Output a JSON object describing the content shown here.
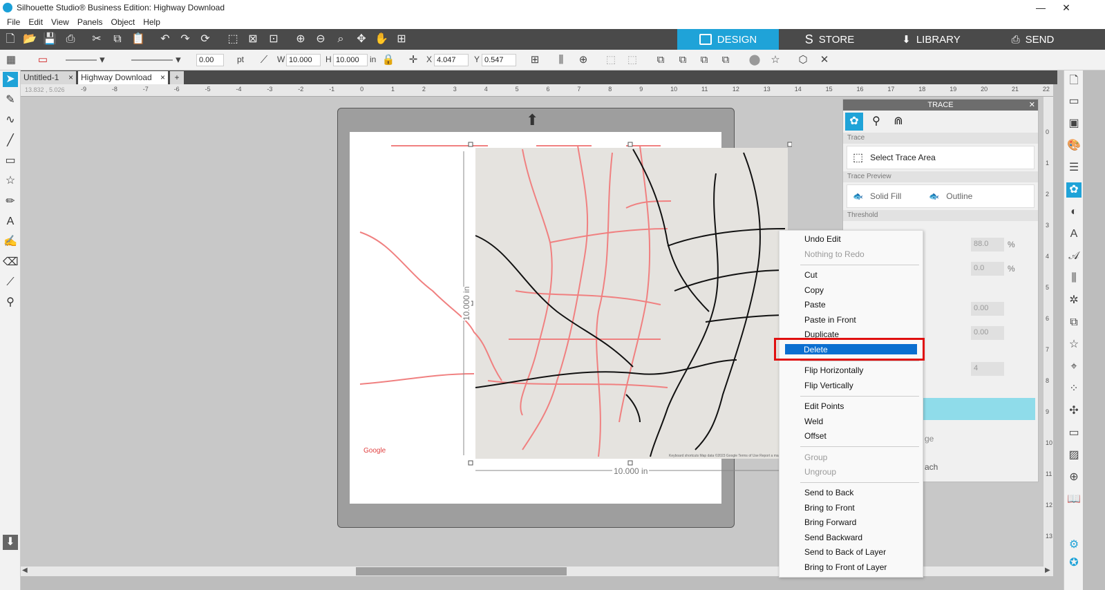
{
  "window": {
    "title": "Silhouette Studio® Business Edition: Highway Download",
    "minimize": "—",
    "maximize": "❐",
    "close": "✕"
  },
  "menu": [
    "File",
    "Edit",
    "View",
    "Panels",
    "Object",
    "Help"
  ],
  "nav_tabs": [
    {
      "label": "DESIGN",
      "active": true
    },
    {
      "label": "STORE"
    },
    {
      "label": "LIBRARY"
    },
    {
      "label": "SEND"
    }
  ],
  "properties": {
    "line_width": "0.00",
    "line_unit": "pt",
    "w_label": "W",
    "w_value": "10.000",
    "h_label": "H",
    "h_value": "10.000",
    "size_unit": "in",
    "x_label": "X",
    "x_value": "4.047",
    "y_label": "Y",
    "y_value": "0.547"
  },
  "doc_tabs": [
    {
      "label": "Untitled-1"
    },
    {
      "label": "Highway Download",
      "active": true
    }
  ],
  "add_tab": "+",
  "ruler": {
    "coords": "13.832 , 5.026",
    "h_ticks": [
      "-9",
      "-8",
      "-7",
      "-6",
      "-5",
      "-4",
      "-3",
      "-2",
      "-1",
      "0",
      "1",
      "2",
      "3",
      "4",
      "5",
      "6",
      "7",
      "8",
      "9",
      "10",
      "11",
      "12",
      "13",
      "14",
      "15",
      "16",
      "17",
      "18",
      "19",
      "20",
      "21",
      "22"
    ],
    "v_ticks": [
      "0",
      "1",
      "2",
      "3",
      "4",
      "5",
      "6",
      "7",
      "8",
      "9",
      "10",
      "11",
      "12",
      "13"
    ]
  },
  "canvas": {
    "height_dim": "10.000 in",
    "width_dim": "10.000 in",
    "google_logo": "Google",
    "map_footer": "Keyboard shortcuts   Map data ©2023 Google   Terms of Use   Report a map error"
  },
  "trace_panel": {
    "title": "TRACE",
    "section_trace": "Trace",
    "select_trace_area": "Select Trace Area",
    "section_preview": "Trace Preview",
    "solid_fill": "Solid Fill",
    "outline": "Outline",
    "section_threshold": "Threshold",
    "threshold_value": "88.0",
    "threshold_unit": "%",
    "field2_value": "0.0",
    "field2_unit": "%",
    "field3_value": "0.00",
    "field4_value": "0.00",
    "field5_value": "4",
    "partial1": "ge",
    "partial2": "ach"
  },
  "context_menu": [
    {
      "label": "Undo Edit",
      "enabled": true
    },
    {
      "label": "Nothing to Redo",
      "enabled": false
    },
    {
      "label": "Cut",
      "enabled": true
    },
    {
      "label": "Copy",
      "enabled": true
    },
    {
      "label": "Paste",
      "enabled": true
    },
    {
      "label": "Paste in Front",
      "enabled": true
    },
    {
      "label": "Duplicate",
      "enabled": true
    },
    {
      "label": "Delete",
      "enabled": true,
      "highlighted": true
    },
    {
      "label": "Flip Horizontally",
      "enabled": true
    },
    {
      "label": "Flip Vertically",
      "enabled": true
    },
    {
      "label": "Edit Points",
      "enabled": true
    },
    {
      "label": "Weld",
      "enabled": true
    },
    {
      "label": "Offset",
      "enabled": true
    },
    {
      "label": "Group",
      "enabled": false
    },
    {
      "label": "Ungroup",
      "enabled": false
    },
    {
      "label": "Send to Back",
      "enabled": true
    },
    {
      "label": "Bring to Front",
      "enabled": true
    },
    {
      "label": "Bring Forward",
      "enabled": true
    },
    {
      "label": "Send Backward",
      "enabled": true
    },
    {
      "label": "Send to Back of Layer",
      "enabled": true
    },
    {
      "label": "Bring to Front of Layer",
      "enabled": true
    }
  ],
  "colors": {
    "accent": "#1fa3d8",
    "highlight": "#0b6fd0",
    "annotation": "#e01010"
  }
}
